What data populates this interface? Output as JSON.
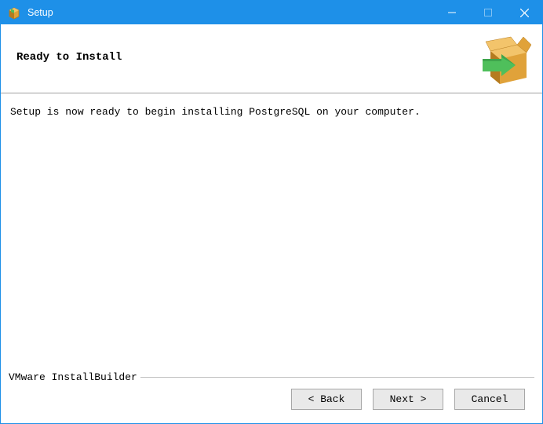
{
  "window": {
    "title": "Setup"
  },
  "header": {
    "title": "Ready to Install"
  },
  "body": {
    "message": "Setup is now ready to begin installing PostgreSQL on your computer."
  },
  "footer": {
    "legend": "VMware InstallBuilder",
    "buttons": {
      "back": "< Back",
      "next": "Next >",
      "cancel": "Cancel"
    }
  },
  "colors": {
    "titlebar": "#1e90e8",
    "box_brown_dark": "#b57b1f",
    "box_brown_mid": "#e0a23a",
    "box_brown_light": "#f3c46b",
    "arrow_green_dark": "#2e8b3d",
    "arrow_green_light": "#4fbf5b"
  }
}
